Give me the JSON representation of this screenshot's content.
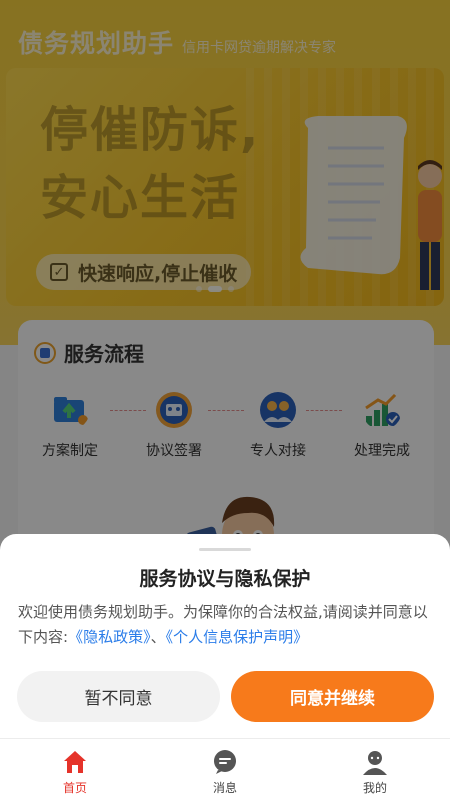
{
  "header": {
    "title": "债务规划助手",
    "subtitle": "信用卡网贷逾期解决专家"
  },
  "banner": {
    "title_line1": "停催防诉,",
    "title_line2": "安心生活",
    "pill_text": "快速响应,停止催收"
  },
  "service": {
    "title": "服务流程",
    "steps": [
      {
        "label": "方案制定",
        "icon": "folder-upload-icon"
      },
      {
        "label": "协议签署",
        "icon": "contract-icon"
      },
      {
        "label": "专人对接",
        "icon": "people-icon"
      },
      {
        "label": "处理完成",
        "icon": "growth-check-icon"
      }
    ]
  },
  "dialog": {
    "title": "服务协议与隐私保护",
    "body_text": "欢迎使用债务规划助手。为保障你的合法权益,请阅读并同意以下内容:",
    "link_privacy": "《隐私政策》",
    "separator": "、",
    "link_personal": "《个人信息保护声明》",
    "decline_label": "暂不同意",
    "agree_label": "同意并继续"
  },
  "tabbar": {
    "items": [
      {
        "label": "首页",
        "icon": "home-icon",
        "active": true
      },
      {
        "label": "消息",
        "icon": "message-icon",
        "active": false
      },
      {
        "label": "我的",
        "icon": "profile-icon",
        "active": false
      }
    ]
  },
  "colors": {
    "accent_orange": "#f77a1b",
    "link_blue": "#2b7de9",
    "tab_active_red": "#e5332a",
    "banner_yellow": "#f6c42a"
  }
}
